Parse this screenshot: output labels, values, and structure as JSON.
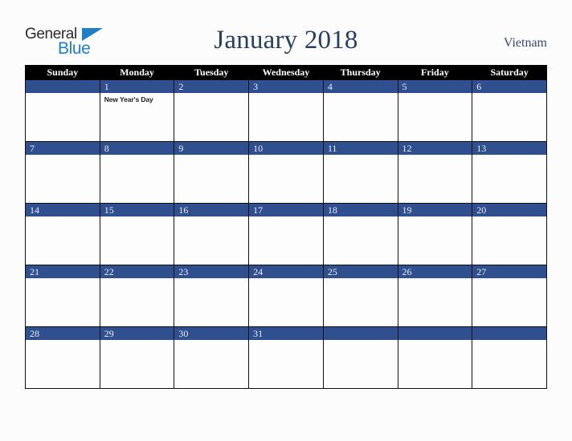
{
  "brand": {
    "name_part1": "General",
    "name_part2": "Blue",
    "colors": {
      "word1": "#2b2b2b",
      "word2": "#1f7fc4",
      "triangle": "#1f7fc4"
    }
  },
  "header": {
    "title": "January 2018",
    "region": "Vietnam",
    "title_color": "#27405f",
    "region_color": "#33496b"
  },
  "calendar": {
    "month": "January",
    "year": "2018",
    "theme": {
      "header_bg": "#000000",
      "header_text": "#ffffff",
      "day_band_bg": "#2f4f8f",
      "day_band_text": "#e9edf5",
      "cell_bg": "#fdfdfe",
      "grid_line": "#101010",
      "page_bg": "#fcfcfd"
    },
    "weekday_headers": [
      "Sunday",
      "Monday",
      "Tuesday",
      "Wednesday",
      "Thursday",
      "Friday",
      "Saturday"
    ],
    "weeks": [
      [
        {
          "day": "",
          "events": []
        },
        {
          "day": "1",
          "events": [
            "New Year's Day"
          ]
        },
        {
          "day": "2",
          "events": []
        },
        {
          "day": "3",
          "events": []
        },
        {
          "day": "4",
          "events": []
        },
        {
          "day": "5",
          "events": []
        },
        {
          "day": "6",
          "events": []
        }
      ],
      [
        {
          "day": "7",
          "events": []
        },
        {
          "day": "8",
          "events": []
        },
        {
          "day": "9",
          "events": []
        },
        {
          "day": "10",
          "events": []
        },
        {
          "day": "11",
          "events": []
        },
        {
          "day": "12",
          "events": []
        },
        {
          "day": "13",
          "events": []
        }
      ],
      [
        {
          "day": "14",
          "events": []
        },
        {
          "day": "15",
          "events": []
        },
        {
          "day": "16",
          "events": []
        },
        {
          "day": "17",
          "events": []
        },
        {
          "day": "18",
          "events": []
        },
        {
          "day": "19",
          "events": []
        },
        {
          "day": "20",
          "events": []
        }
      ],
      [
        {
          "day": "21",
          "events": []
        },
        {
          "day": "22",
          "events": []
        },
        {
          "day": "23",
          "events": []
        },
        {
          "day": "24",
          "events": []
        },
        {
          "day": "25",
          "events": []
        },
        {
          "day": "26",
          "events": []
        },
        {
          "day": "27",
          "events": []
        }
      ],
      [
        {
          "day": "28",
          "events": []
        },
        {
          "day": "29",
          "events": []
        },
        {
          "day": "30",
          "events": []
        },
        {
          "day": "31",
          "events": []
        },
        {
          "day": "",
          "events": []
        },
        {
          "day": "",
          "events": []
        },
        {
          "day": "",
          "events": []
        }
      ]
    ]
  }
}
